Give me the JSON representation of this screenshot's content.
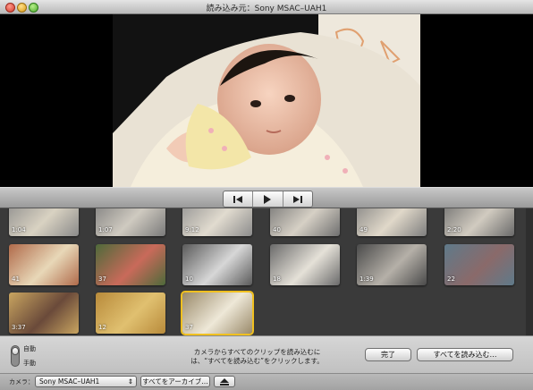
{
  "window": {
    "title": "読み込み元：Sony MSAC–UAH1"
  },
  "clips": [
    {
      "duration": "1:04",
      "selected": false,
      "colors": [
        "#8a8a8a",
        "#d9d2c2"
      ]
    },
    {
      "duration": "1:07",
      "selected": false,
      "colors": [
        "#7a7a7a",
        "#cfcac0"
      ]
    },
    {
      "duration": "9:12",
      "selected": false,
      "colors": [
        "#8c8c8c",
        "#e1dbcf"
      ]
    },
    {
      "duration": "40",
      "selected": false,
      "colors": [
        "#6f6f6f",
        "#d6d0c5"
      ]
    },
    {
      "duration": "49",
      "selected": false,
      "colors": [
        "#7e7e7e",
        "#e0d8c9"
      ]
    },
    {
      "duration": "2:20",
      "selected": false,
      "colors": [
        "#6a6a6a",
        "#d1cbc0"
      ]
    },
    {
      "duration": "41",
      "selected": false,
      "colors": [
        "#b06a4a",
        "#e8d8b8"
      ]
    },
    {
      "duration": "37",
      "selected": false,
      "colors": [
        "#4e6a3a",
        "#c96a5a"
      ]
    },
    {
      "duration": "10",
      "selected": false,
      "colors": [
        "#5a5a5a",
        "#d7d7d7"
      ]
    },
    {
      "duration": "18",
      "selected": false,
      "colors": [
        "#6a6a6a",
        "#e5e1d8"
      ]
    },
    {
      "duration": "1:39",
      "selected": false,
      "colors": [
        "#4a4a4a",
        "#b5b0a8"
      ]
    },
    {
      "duration": "22",
      "selected": false,
      "colors": [
        "#5f7a8a",
        "#8a6a6a"
      ]
    },
    {
      "duration": "3:37",
      "selected": false,
      "colors": [
        "#c9a560",
        "#6a4a3a"
      ]
    },
    {
      "duration": "12",
      "selected": false,
      "colors": [
        "#b88a3a",
        "#e0c070"
      ]
    },
    {
      "duration": "37",
      "selected": true,
      "colors": [
        "#9a8a6a",
        "#eee8d8"
      ]
    }
  ],
  "bottom": {
    "mode_auto": "自動",
    "mode_manual": "手動",
    "info": "カメラからすべてのクリップを読み込むには、“すべてを読み込む”をクリックします。",
    "done_button": "完了",
    "import_all_button": "すべてを読み込む…"
  },
  "strip": {
    "camera_label": "カメラ：",
    "camera_value": "Sony MSAC–UAH1",
    "archive_button": "すべてをアーカイブ…"
  },
  "colors": {
    "selection": "#f0c020"
  }
}
